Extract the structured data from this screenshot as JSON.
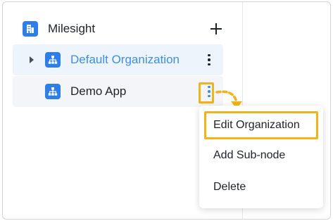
{
  "tree": {
    "root": {
      "label": "Milesight",
      "icon": "building-icon"
    },
    "nodes": [
      {
        "label": "Default Organization",
        "icon": "org-tree-icon",
        "expandable": true,
        "selected": true
      },
      {
        "label": "Demo App",
        "icon": "org-tree-icon",
        "expandable": false,
        "selected": false
      }
    ]
  },
  "context_menu": {
    "items": [
      {
        "label": "Edit Organization"
      },
      {
        "label": "Add Sub-node"
      },
      {
        "label": "Delete"
      }
    ]
  },
  "colors": {
    "accent": "#2f7ee5",
    "active_text": "#3d8ee5",
    "highlight": "#f2b31a"
  }
}
